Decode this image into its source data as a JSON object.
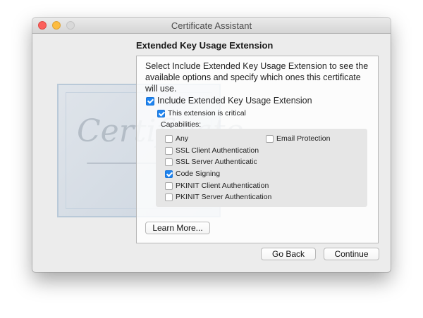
{
  "window": {
    "title": "Certificate Assistant",
    "watermark_word": "Certificate"
  },
  "heading": "Extended Key Usage Extension",
  "description": "Select Include Extended Key Usage Extension to see the available options and specify which ones this certificate will use.",
  "include_option": {
    "label": "Include Extended Key Usage Extension",
    "checked": true
  },
  "critical_option": {
    "label": "This extension is critical",
    "checked": true
  },
  "capabilities": {
    "label": "Capabilities:",
    "items": [
      {
        "label": "Any",
        "checked": false
      },
      {
        "label": "Email Protection",
        "checked": false
      },
      {
        "label": "SSL Client Authentication",
        "checked": false
      },
      {
        "label": "SSL Server Authentication",
        "checked": false
      },
      {
        "label": "Code Signing",
        "checked": true
      },
      {
        "label": "PKINIT Client Authentication",
        "checked": false
      },
      {
        "label": "PKINIT Server Authentication",
        "checked": false
      }
    ]
  },
  "buttons": {
    "learn_more": "Learn More...",
    "go_back": "Go Back",
    "continue": "Continue"
  }
}
